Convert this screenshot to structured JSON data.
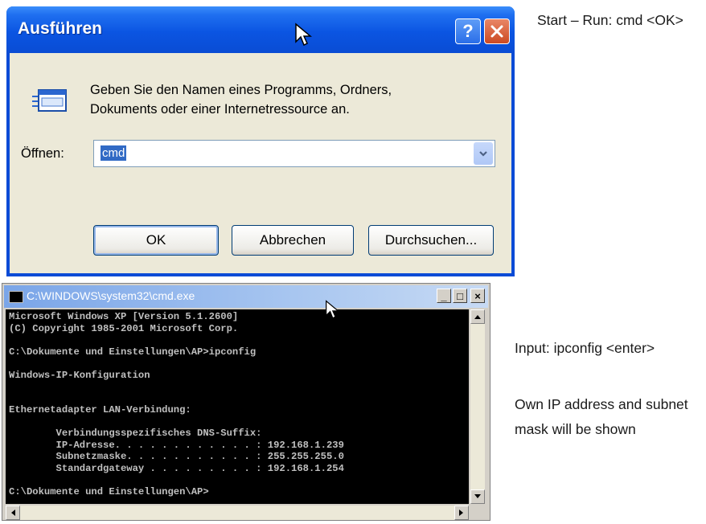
{
  "run_dialog": {
    "title": "Ausführen",
    "help_button": "?",
    "description_line1": "Geben Sie den Namen eines Programms, Ordners,",
    "description_line2": "Dokuments oder einer Internetressource an.",
    "open_label": "Öffnen:",
    "open_value": "cmd",
    "ok_label": "OK",
    "cancel_label": "Abbrechen",
    "browse_label": "Durchsuchen..."
  },
  "cmd_window": {
    "title": "C:\\WINDOWS\\system32\\cmd.exe",
    "controls": {
      "minimize": "_",
      "maximize": "□",
      "close": "×"
    },
    "console_output": "Microsoft Windows XP [Version 5.1.2600]\n(C) Copyright 1985-2001 Microsoft Corp.\n\nC:\\Dokumente und Einstellungen\\AP>ipconfig\n\nWindows-IP-Konfiguration\n\n\nEthernetadapter LAN-Verbindung:\n\n        Verbindungsspezifisches DNS-Suffix:\n        IP-Adresse. . . . . . . . . . . . : 192.168.1.239\n        Subnetzmaske. . . . . . . . . . . : 255.255.255.0\n        Standardgateway . . . . . . . . . : 192.168.1.254\n\nC:\\Dokumente und Einstellungen\\AP>"
  },
  "notes": {
    "run_step": "Start – Run: cmd <OK>",
    "input_step": "Input: ipconfig <enter>",
    "result_line1": "Own IP address and subnet",
    "result_line2": "mask will be shown"
  },
  "icons": {
    "help": "question-mark-icon",
    "close": "close-x-icon",
    "run": "run-window-icon",
    "dropdown": "chevron-down-icon",
    "cmd": "console-icon"
  },
  "colors": {
    "xp_title_blue": "#0b55e2",
    "dialog_face": "#ece9d8",
    "selection": "#316ac5",
    "console_bg": "#000000",
    "console_fg": "#c0c0c0"
  }
}
